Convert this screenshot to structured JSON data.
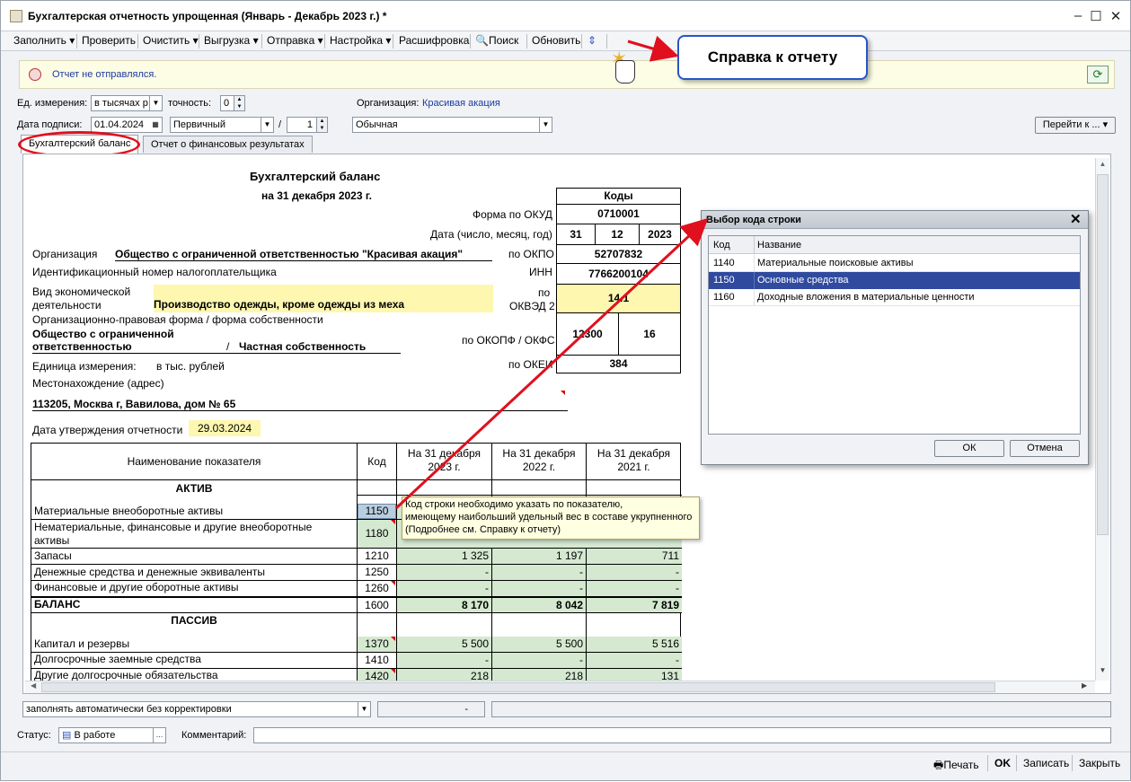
{
  "window": {
    "title": "Бухгалтерская отчетность упрощенная (Январь - Декабрь 2023 г.) *"
  },
  "toolbar": {
    "fill": "Заполнить",
    "check": "Проверить",
    "clear": "Очистить",
    "export": "Выгрузка",
    "send": "Отправка",
    "settings": "Настройка",
    "decoding": "Расшифровка",
    "search": "Поиск",
    "refresh": "Обновить"
  },
  "callout": {
    "text": "Справка к отчету"
  },
  "notice": {
    "text": "Отчет не отправлялся."
  },
  "params": {
    "unit_label": "Ед. измерения:",
    "unit_value": "в тысячах р",
    "precision_label": "точность:",
    "precision_value": "0",
    "org_label": "Организация:",
    "org_value": "Красивая акация",
    "sign_date_label": "Дата подписи:",
    "sign_date_value": "01.04.2024",
    "kind_value": "Первичный",
    "slash": "/",
    "corr_number": "1",
    "mode_value": "Обычная",
    "goto_label": "Перейти к ..."
  },
  "tabs": {
    "balance": "Бухгалтерский баланс",
    "fin_results": "Отчет о финансовых результатах"
  },
  "doc": {
    "title": "Бухгалтерский баланс",
    "subtitle": "на 31 декабря 2023 г.",
    "codes_header": "Коды",
    "okud_label": "Форма по ОКУД",
    "okud": "0710001",
    "date_label": "Дата (число, месяц, год)",
    "d": "31",
    "m": "12",
    "y": "2023",
    "org_label": "Организация",
    "org_name": "Общество с ограниченной ответственностью \"Красивая акация\"",
    "okpo_label": "по ОКПО",
    "okpo": "52707832",
    "inn_text": "Идентификационный номер налогоплательщика",
    "inn_label": "ИНН",
    "inn": "7766200104",
    "activity_label1": "Вид экономической",
    "activity_label2": "деятельности",
    "activity": "Производство одежды, кроме одежды из меха",
    "okved_label1": "по",
    "okved_label2": "ОКВЭД 2",
    "okved": "14.1",
    "legal_form_label": "Организационно-правовая форма / форма собственности",
    "legal_form1": "Общество с ограниченной",
    "legal_form2": "ответственностью",
    "ownership": "Частная собственность",
    "okopf_label": "по ОКОПФ / ОКФС",
    "okopf": "12300",
    "okfs": "16",
    "unit_label": "Единица измерения:",
    "unit": "в тыс. рублей",
    "okei_label": "по ОКЕИ",
    "okei": "384",
    "address_label": "Местонахождение (адрес)",
    "address": "113205, Москва г, Вавилова, дом № 65",
    "approval_label": "Дата утверждения отчетности",
    "approval_date": "29.03.2024"
  },
  "table": {
    "h_name": "Наименование показателя",
    "h_code": "Код",
    "h_2023a": "На 31 декабря",
    "h_2023b": "2023 г.",
    "h_2022a": "На 31 декабря",
    "h_2022b": "2022 г.",
    "h_2021a": "На 31 декабря",
    "h_2021b": "2021 г.",
    "active": "АКТИВ",
    "passive": "ПАССИВ",
    "rows": [
      {
        "name": "Материальные внеоборотные активы",
        "code": "1150",
        "v1": "",
        "v2": "",
        "v3": ""
      },
      {
        "name": "Нематериальные, финансовые и другие внеоборотные",
        "name2": "активы",
        "code": "1180",
        "v1": "",
        "v2": "",
        "v3": ""
      },
      {
        "name": "Запасы",
        "code": "1210",
        "v1": "1 325",
        "v2": "1 197",
        "v3": "711"
      },
      {
        "name": "Денежные средства и денежные эквиваленты",
        "code": "1250",
        "v1": "-",
        "v2": "-",
        "v3": "-"
      },
      {
        "name": "Финансовые и другие оборотные активы",
        "code": "1260",
        "v1": "-",
        "v2": "-",
        "v3": "-"
      },
      {
        "name": "БАЛАНС",
        "code": "1600",
        "v1": "8 170",
        "v2": "8 042",
        "v3": "7 819"
      },
      {
        "name": "Капитал и резервы",
        "code": "1370",
        "v1": "5 500",
        "v2": "5 500",
        "v3": "5 516"
      },
      {
        "name": "Долгосрочные заемные средства",
        "code": "1410",
        "v1": "-",
        "v2": "-",
        "v3": "-"
      },
      {
        "name": "Другие долгосрочные обязательства",
        "code": "1420",
        "v1": "218",
        "v2": "218",
        "v3": "131"
      }
    ]
  },
  "tooltip": {
    "line1": "Код строки необходимо указать по показателю,",
    "line2": "имеющему наибольший удельный вес в составе укрупненного",
    "line3": "(Подробнее см. Справку к отчету)"
  },
  "dialog": {
    "title": "Выбор кода строки",
    "col_code": "Код",
    "col_name": "Название",
    "items": [
      {
        "code": "1140",
        "name": "Материальные поисковые активы"
      },
      {
        "code": "1150",
        "name": "Основные средства"
      },
      {
        "code": "1160",
        "name": "Доходные вложения в материальные ценности"
      }
    ],
    "ok": "ОК",
    "cancel": "Отмена"
  },
  "bottom": {
    "fill_mode": "заполнять автоматически без корректировки",
    "dash": "-",
    "status_label": "Статус:",
    "status_value": "В работе",
    "comment_label": "Комментарий:",
    "print": "Печать",
    "ok": "OK",
    "save": "Записать",
    "close": "Закрыть"
  },
  "colors": {
    "accent_red": "#e0101e",
    "selection": "#2f4a9e",
    "callout_border": "#2a55c6"
  }
}
